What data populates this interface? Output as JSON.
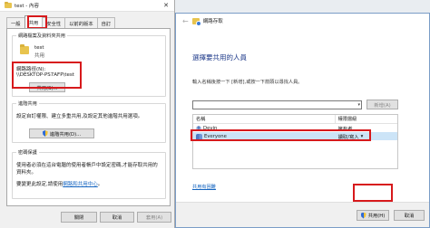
{
  "properties": {
    "title": "test - 內容",
    "tabs": [
      "一般",
      "共用",
      "安全性",
      "以前的版本",
      "自訂"
    ],
    "group1": {
      "title": "網路檔案及資料夾共用",
      "folder_name": "test",
      "share_state": "共用",
      "path_label": "網路路徑(N):",
      "path_value": "\\\\DESKTOP-PS7AFP\\test",
      "share_button": "共用(S)..."
    },
    "group2": {
      "title": "進階共用",
      "desc_line1": "設定自訂權限、建立多重共用,及設定其他進階共用選項。",
      "advanced_button": "進階共用(D)..."
    },
    "group3": {
      "title": "密碼保護",
      "desc_line1": "使用者必須在這台電腦的使用者帳戶中設定密碼,才能存取共用的",
      "desc_line2": "資料夾。",
      "desc_line3": "要變更此設定,請使用",
      "link": "網路和共用中心",
      "desc_tail": "。"
    },
    "footer": {
      "ok": "關閉",
      "cancel": "取消",
      "apply": "套用(A)"
    }
  },
  "wizard": {
    "title": "網路存取",
    "heading": "選擇要共用的人員",
    "description": "輸入名稱後按一下 [新增],或按一下箭頭以尋找人員。",
    "input_value": "",
    "add_button": "新增(A)",
    "columns": [
      "名稱",
      "權限層級"
    ],
    "rows": [
      {
        "name": "Devin",
        "permission": "擁有者"
      },
      {
        "name": "Everyone",
        "permission": "讀取/寫入"
      }
    ],
    "link": "共用有困難",
    "share_button": "共用(H)",
    "cancel_button": "取消"
  },
  "colors": {
    "highlight_box": "#d7191c",
    "heading": "#1e3a8a",
    "link": "#1565c0",
    "selection": "#cce4f7"
  }
}
